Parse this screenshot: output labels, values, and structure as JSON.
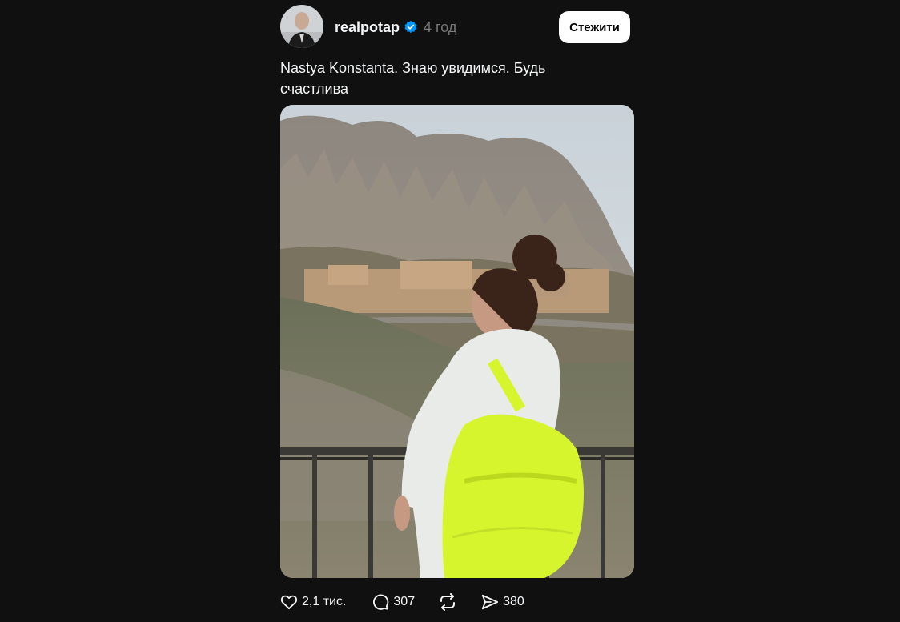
{
  "post": {
    "username": "realpotap",
    "verified": true,
    "time": "4 год",
    "follow_label": "Стежити",
    "caption": "Nastya Konstanta. Знаю увидимся. Будь счастлива",
    "likes": "2,1 тис.",
    "comments": "307",
    "shares": "380"
  },
  "colors": {
    "background": "#101010",
    "verified_badge": "#0095f6",
    "text_primary": "#f3f5f7",
    "text_secondary": "#777777",
    "backpack": "#d7f52c"
  },
  "icons": {
    "avatar": "avatar",
    "verified": "verified-badge-icon",
    "like": "heart-icon",
    "comment": "comment-bubble-icon",
    "repost": "repost-icon",
    "share": "send-icon"
  }
}
